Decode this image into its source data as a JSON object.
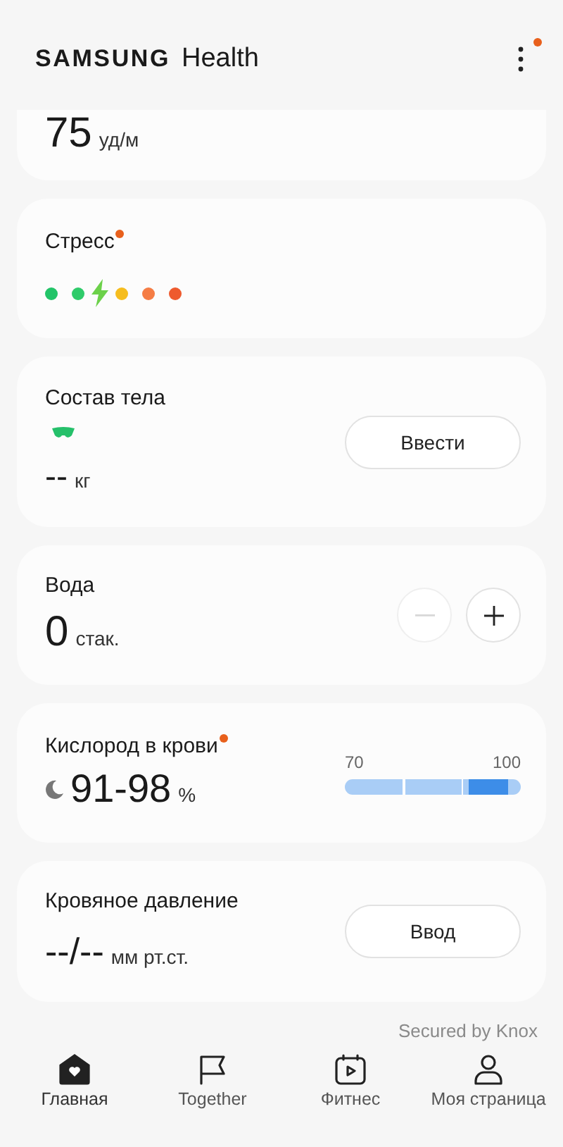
{
  "header": {
    "brand": "SAMSUNG",
    "app": "Health",
    "menu_badge": true
  },
  "cards": [
    {
      "kind": "partial",
      "value": "75",
      "unit": "уд/м"
    },
    {
      "kind": "stress",
      "title": "Стресс",
      "badge": true,
      "scale": [
        {
          "kind": "dot",
          "color": "#22c468"
        },
        {
          "kind": "dot",
          "color": "#2fcb6a"
        },
        {
          "kind": "marker",
          "color": "#6cd14a"
        },
        {
          "kind": "dot",
          "color": "#f6bd1e"
        },
        {
          "kind": "dot",
          "color": "#f57d45"
        },
        {
          "kind": "dot",
          "color": "#ee5a2e"
        }
      ]
    },
    {
      "kind": "body",
      "title": "Состав тела",
      "value": "--",
      "unit": "кг",
      "button": "Ввести"
    },
    {
      "kind": "water",
      "title": "Вода",
      "value": "0",
      "unit": "стак.",
      "minus_disabled": true,
      "plus_disabled": false
    },
    {
      "kind": "oxygen",
      "title": "Кислород в крови",
      "badge": true,
      "value": "91-98",
      "unit": "%",
      "scale_min": "70",
      "scale_max": "100",
      "level": 0.93
    },
    {
      "kind": "pressure",
      "title": "Кровяное давление",
      "value": "--/--",
      "unit": "мм рт.ст.",
      "button": "Ввод"
    }
  ],
  "footer_note": "Secured by Knox",
  "nav": [
    {
      "kind": "home",
      "label": "Главная",
      "selected": true
    },
    {
      "kind": "flag",
      "label": "Together",
      "selected": false
    },
    {
      "kind": "fitness",
      "label": "Фитнес",
      "selected": false
    },
    {
      "kind": "person",
      "label": "Моя страница",
      "selected": false
    }
  ]
}
